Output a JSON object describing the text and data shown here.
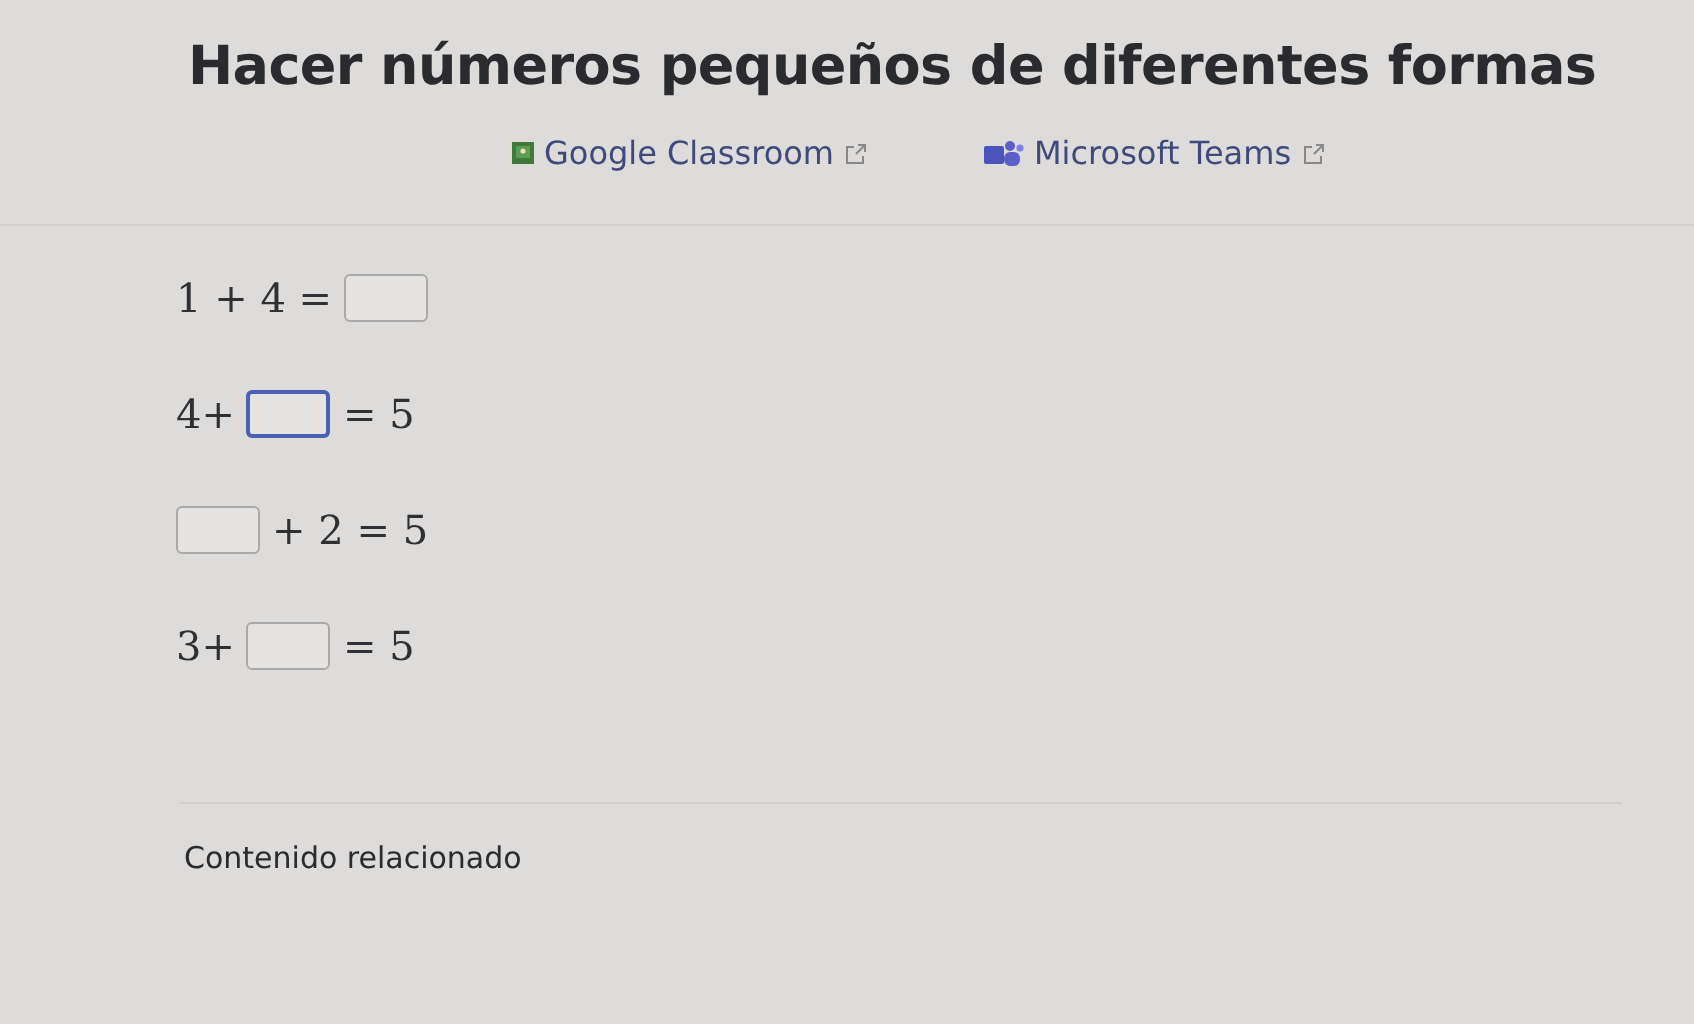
{
  "title": "Hacer números pequeños de diferentes formas",
  "share_links": [
    {
      "label": "Google Classroom",
      "kind": "classroom"
    },
    {
      "label": "Microsoft Teams",
      "kind": "teams"
    }
  ],
  "exercises": [
    {
      "parts": [
        {
          "kind": "text",
          "text": "1 + 4 ="
        },
        {
          "kind": "blank",
          "focused": false
        }
      ]
    },
    {
      "parts": [
        {
          "kind": "text",
          "text": "4+"
        },
        {
          "kind": "blank",
          "focused": true
        },
        {
          "kind": "text",
          "text": "= 5"
        }
      ]
    },
    {
      "parts": [
        {
          "kind": "blank",
          "focused": false
        },
        {
          "kind": "text",
          "text": "+ 2 = 5"
        }
      ]
    },
    {
      "parts": [
        {
          "kind": "text",
          "text": "3+"
        },
        {
          "kind": "blank",
          "focused": false
        },
        {
          "kind": "text",
          "text": "= 5"
        }
      ]
    }
  ],
  "related_heading": "Contenido relacionado"
}
